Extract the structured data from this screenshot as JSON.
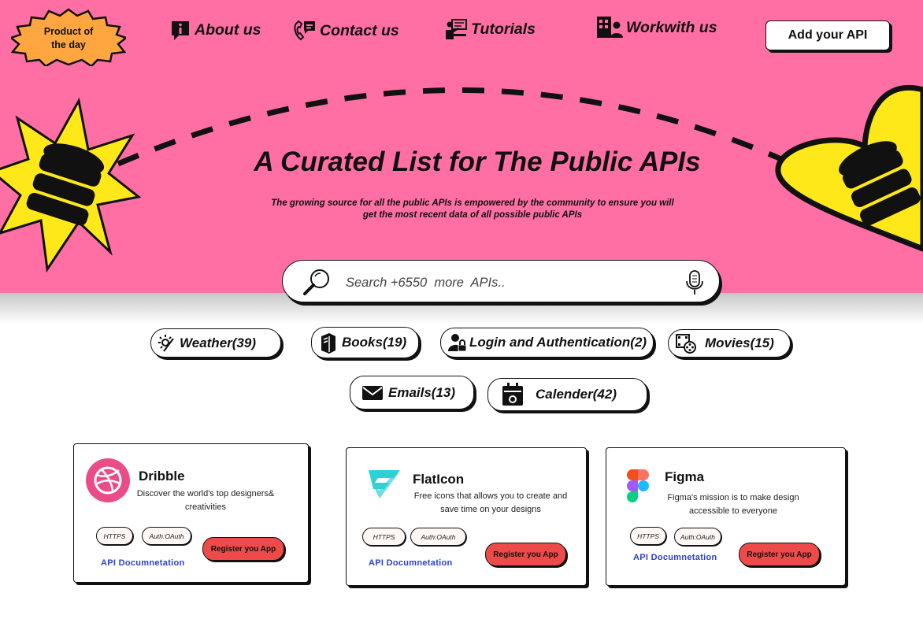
{
  "badge": {
    "line1": "Product of",
    "line2": "the day"
  },
  "nav": [
    {
      "label": "About us",
      "icon": "info-icon"
    },
    {
      "label": "Contact us",
      "icon": "phone-chat-icon"
    },
    {
      "label": "Tutorials",
      "icon": "teaching-icon"
    },
    {
      "label": "Workwith us",
      "icon": "building-person-icon"
    }
  ],
  "add_api_label": "Add your API",
  "hero": {
    "title": "A Curated List for The Public APIs",
    "subtitle_line1": "The growing source for all the public APIs is empowered by the community to ensure you will",
    "subtitle_line2": "get the most recent data of all possible public APIs"
  },
  "search": {
    "placeholder": "Search +6550  more  APIs..",
    "icon": "magnifier-icon",
    "mic_icon": "microphone-icon"
  },
  "categories": [
    {
      "label": "Weather(39)",
      "icon": "weather-icon"
    },
    {
      "label": "Books(19)",
      "icon": "books-icon"
    },
    {
      "label": "Login and Authentication(2)",
      "icon": "user-lock-icon"
    },
    {
      "label": "Movies(15)",
      "icon": "movie-reel-icon"
    },
    {
      "label": "Emails(13)",
      "icon": "envelope-icon"
    },
    {
      "label": "Calender(42)",
      "icon": "calendar-icon"
    }
  ],
  "cards": [
    {
      "name": "Dribble",
      "desc_line1": "Discover the world's top designers&",
      "desc_line2": "creativities",
      "tag1": "HTTPS",
      "tag2": "Auth:OAuth",
      "register": "Register you App",
      "docs": "API Documnetation",
      "logo": "dribbble-logo",
      "logo_color": "#ea4c89"
    },
    {
      "name": "FlatIcon",
      "desc_line1": "Free icons that allows you to create and",
      "desc_line2": "save time on your designs",
      "tag1": "HTTPS",
      "tag2": "Auth:OAuth",
      "register": "Register you App",
      "docs": "API Documnetation",
      "logo": "flaticon-logo",
      "logo_color": "#2ed2d6"
    },
    {
      "name": "Figma",
      "desc_line1": "Figma's mission is to make design",
      "desc_line2": "accessible to everyone",
      "tag1": "HTTPS",
      "tag2": "Auth:OAuth",
      "register": "Register you App",
      "docs": "API Documnetation",
      "logo": "figma-logo",
      "logo_color": "#f24e1e"
    }
  ],
  "colors": {
    "hero_background": "#ff6fa3",
    "accent_yellow": "#ffe81a",
    "register_button": "#ef4a4a",
    "docs_link": "#2b3fd6"
  }
}
